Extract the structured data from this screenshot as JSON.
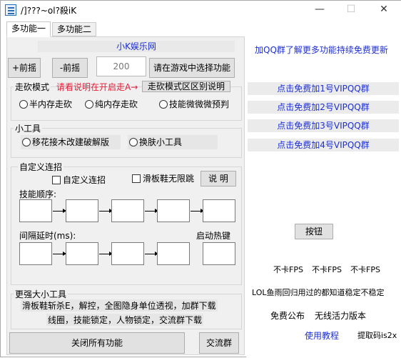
{
  "window": {
    "title": "/]???~ol?殺iK",
    "minimize": "—",
    "maximize": "☐",
    "close": "✕"
  },
  "tabs": [
    {
      "label": "多功能一"
    },
    {
      "label": "多功能二"
    }
  ],
  "banner": "小K娱乐网",
  "top_controls": {
    "btn_forward_plus": "+前摇",
    "btn_forward_minus": "-前摇",
    "delay_value": "200",
    "btn_select_func": "请在游戏中选择功能"
  },
  "walk_mode": {
    "label": "走砍模式",
    "hint": "请看说明在开启走A→",
    "explain_button": "走砍模式区区别说明",
    "options": [
      "半内存走砍",
      "纯内存走砍",
      "技能微微微预判"
    ]
  },
  "small_tools": {
    "label": "小工具",
    "options": [
      "移花接木改建破解版",
      "换肤小工具"
    ]
  },
  "custom_combo": {
    "label": "自定义连招",
    "checkbox_custom": "自定义连招",
    "checkbox_skate": "滑板鞋无限跳",
    "explain_button": "说 明",
    "skill_order_label": "技能顺序:",
    "interval_label": "间隔延时(ms):",
    "hotkey_label": "启动热键"
  },
  "stronger_tools": {
    "label": "更强大小工具",
    "line1": "滑板鞋斩杀E，解控，全图隐身单位透视，加群下载",
    "line2": "线圈，技能锁定，人物锁定，交流群下载"
  },
  "bottom_buttons": {
    "close_all": "关闭所有功能",
    "community": "交流群"
  },
  "right": {
    "promo": "加QQ群了解更多功能持续免费更新",
    "qq_links": [
      "点击免费加1号VIPQQ群",
      "点击免费加2号VIPQQ群",
      "点击免费加3号VIPQQ群",
      "点击免费加4号VIPQQ群"
    ],
    "button": "按钮",
    "fps": [
      "不卡FPS",
      "不卡FPS",
      "不卡FPS"
    ],
    "notice": "LOL鱼雨回归用过的都知道稳定不稳定",
    "free_publish": "免费公布",
    "wireless": "无线活力版本",
    "tutorial": "使用教程",
    "code": "提取码is2x"
  }
}
